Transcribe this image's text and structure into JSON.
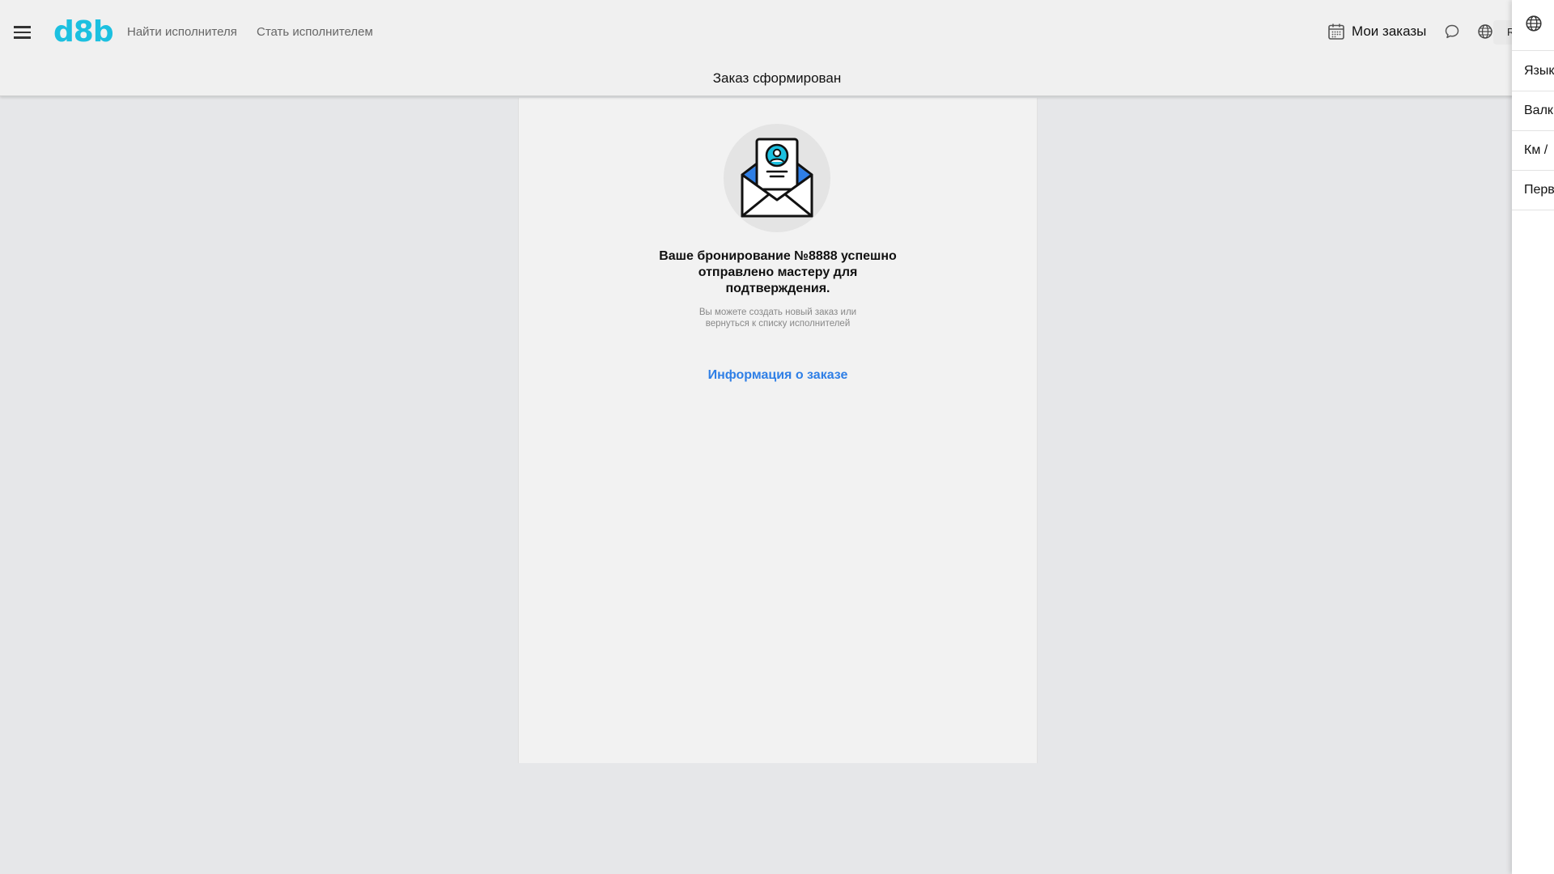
{
  "header": {
    "logo": "d8b",
    "nav": {
      "find_performer": "Найти исполнителя",
      "become_performer": "Стать исполнителем"
    },
    "my_orders": "Мои заказы",
    "language_chip": "R",
    "page_title": "Заказ сформирован"
  },
  "confirmation": {
    "title": "Ваше бронирование №8888 успешно отправлено мастеру для подтверждения.",
    "subtitle": "Вы можете создать новый заказ или вернуться к списку исполнителей",
    "info_link": "Информация о заказе"
  },
  "drawer": {
    "items": [
      "Язык",
      "Валк",
      "Км /",
      "Перв"
    ]
  },
  "colors": {
    "brand": "#1cc0e0",
    "link": "#2f7fe6",
    "envelope_accent": "#2f7fe6",
    "avatar_accent": "#1cc0e0"
  }
}
